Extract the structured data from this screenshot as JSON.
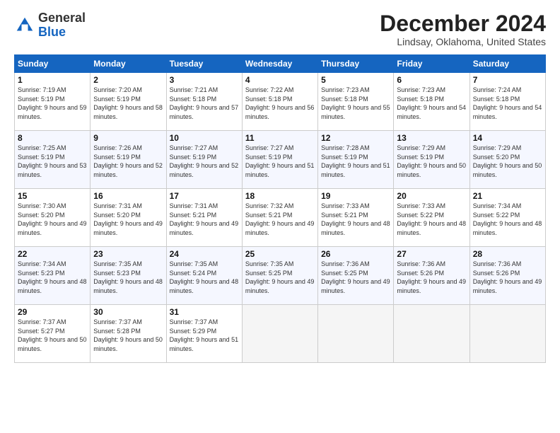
{
  "logo": {
    "general": "General",
    "blue": "Blue"
  },
  "title": "December 2024",
  "location": "Lindsay, Oklahoma, United States",
  "days_of_week": [
    "Sunday",
    "Monday",
    "Tuesday",
    "Wednesday",
    "Thursday",
    "Friday",
    "Saturday"
  ],
  "weeks": [
    [
      {
        "day": "1",
        "sunrise": "Sunrise: 7:19 AM",
        "sunset": "Sunset: 5:19 PM",
        "daylight": "Daylight: 9 hours and 59 minutes."
      },
      {
        "day": "2",
        "sunrise": "Sunrise: 7:20 AM",
        "sunset": "Sunset: 5:19 PM",
        "daylight": "Daylight: 9 hours and 58 minutes."
      },
      {
        "day": "3",
        "sunrise": "Sunrise: 7:21 AM",
        "sunset": "Sunset: 5:18 PM",
        "daylight": "Daylight: 9 hours and 57 minutes."
      },
      {
        "day": "4",
        "sunrise": "Sunrise: 7:22 AM",
        "sunset": "Sunset: 5:18 PM",
        "daylight": "Daylight: 9 hours and 56 minutes."
      },
      {
        "day": "5",
        "sunrise": "Sunrise: 7:23 AM",
        "sunset": "Sunset: 5:18 PM",
        "daylight": "Daylight: 9 hours and 55 minutes."
      },
      {
        "day": "6",
        "sunrise": "Sunrise: 7:23 AM",
        "sunset": "Sunset: 5:18 PM",
        "daylight": "Daylight: 9 hours and 54 minutes."
      },
      {
        "day": "7",
        "sunrise": "Sunrise: 7:24 AM",
        "sunset": "Sunset: 5:18 PM",
        "daylight": "Daylight: 9 hours and 54 minutes."
      }
    ],
    [
      {
        "day": "8",
        "sunrise": "Sunrise: 7:25 AM",
        "sunset": "Sunset: 5:19 PM",
        "daylight": "Daylight: 9 hours and 53 minutes."
      },
      {
        "day": "9",
        "sunrise": "Sunrise: 7:26 AM",
        "sunset": "Sunset: 5:19 PM",
        "daylight": "Daylight: 9 hours and 52 minutes."
      },
      {
        "day": "10",
        "sunrise": "Sunrise: 7:27 AM",
        "sunset": "Sunset: 5:19 PM",
        "daylight": "Daylight: 9 hours and 52 minutes."
      },
      {
        "day": "11",
        "sunrise": "Sunrise: 7:27 AM",
        "sunset": "Sunset: 5:19 PM",
        "daylight": "Daylight: 9 hours and 51 minutes."
      },
      {
        "day": "12",
        "sunrise": "Sunrise: 7:28 AM",
        "sunset": "Sunset: 5:19 PM",
        "daylight": "Daylight: 9 hours and 51 minutes."
      },
      {
        "day": "13",
        "sunrise": "Sunrise: 7:29 AM",
        "sunset": "Sunset: 5:19 PM",
        "daylight": "Daylight: 9 hours and 50 minutes."
      },
      {
        "day": "14",
        "sunrise": "Sunrise: 7:29 AM",
        "sunset": "Sunset: 5:20 PM",
        "daylight": "Daylight: 9 hours and 50 minutes."
      }
    ],
    [
      {
        "day": "15",
        "sunrise": "Sunrise: 7:30 AM",
        "sunset": "Sunset: 5:20 PM",
        "daylight": "Daylight: 9 hours and 49 minutes."
      },
      {
        "day": "16",
        "sunrise": "Sunrise: 7:31 AM",
        "sunset": "Sunset: 5:20 PM",
        "daylight": "Daylight: 9 hours and 49 minutes."
      },
      {
        "day": "17",
        "sunrise": "Sunrise: 7:31 AM",
        "sunset": "Sunset: 5:21 PM",
        "daylight": "Daylight: 9 hours and 49 minutes."
      },
      {
        "day": "18",
        "sunrise": "Sunrise: 7:32 AM",
        "sunset": "Sunset: 5:21 PM",
        "daylight": "Daylight: 9 hours and 49 minutes."
      },
      {
        "day": "19",
        "sunrise": "Sunrise: 7:33 AM",
        "sunset": "Sunset: 5:21 PM",
        "daylight": "Daylight: 9 hours and 48 minutes."
      },
      {
        "day": "20",
        "sunrise": "Sunrise: 7:33 AM",
        "sunset": "Sunset: 5:22 PM",
        "daylight": "Daylight: 9 hours and 48 minutes."
      },
      {
        "day": "21",
        "sunrise": "Sunrise: 7:34 AM",
        "sunset": "Sunset: 5:22 PM",
        "daylight": "Daylight: 9 hours and 48 minutes."
      }
    ],
    [
      {
        "day": "22",
        "sunrise": "Sunrise: 7:34 AM",
        "sunset": "Sunset: 5:23 PM",
        "daylight": "Daylight: 9 hours and 48 minutes."
      },
      {
        "day": "23",
        "sunrise": "Sunrise: 7:35 AM",
        "sunset": "Sunset: 5:23 PM",
        "daylight": "Daylight: 9 hours and 48 minutes."
      },
      {
        "day": "24",
        "sunrise": "Sunrise: 7:35 AM",
        "sunset": "Sunset: 5:24 PM",
        "daylight": "Daylight: 9 hours and 48 minutes."
      },
      {
        "day": "25",
        "sunrise": "Sunrise: 7:35 AM",
        "sunset": "Sunset: 5:25 PM",
        "daylight": "Daylight: 9 hours and 49 minutes."
      },
      {
        "day": "26",
        "sunrise": "Sunrise: 7:36 AM",
        "sunset": "Sunset: 5:25 PM",
        "daylight": "Daylight: 9 hours and 49 minutes."
      },
      {
        "day": "27",
        "sunrise": "Sunrise: 7:36 AM",
        "sunset": "Sunset: 5:26 PM",
        "daylight": "Daylight: 9 hours and 49 minutes."
      },
      {
        "day": "28",
        "sunrise": "Sunrise: 7:36 AM",
        "sunset": "Sunset: 5:26 PM",
        "daylight": "Daylight: 9 hours and 49 minutes."
      }
    ],
    [
      {
        "day": "29",
        "sunrise": "Sunrise: 7:37 AM",
        "sunset": "Sunset: 5:27 PM",
        "daylight": "Daylight: 9 hours and 50 minutes."
      },
      {
        "day": "30",
        "sunrise": "Sunrise: 7:37 AM",
        "sunset": "Sunset: 5:28 PM",
        "daylight": "Daylight: 9 hours and 50 minutes."
      },
      {
        "day": "31",
        "sunrise": "Sunrise: 7:37 AM",
        "sunset": "Sunset: 5:29 PM",
        "daylight": "Daylight: 9 hours and 51 minutes."
      },
      null,
      null,
      null,
      null
    ]
  ]
}
